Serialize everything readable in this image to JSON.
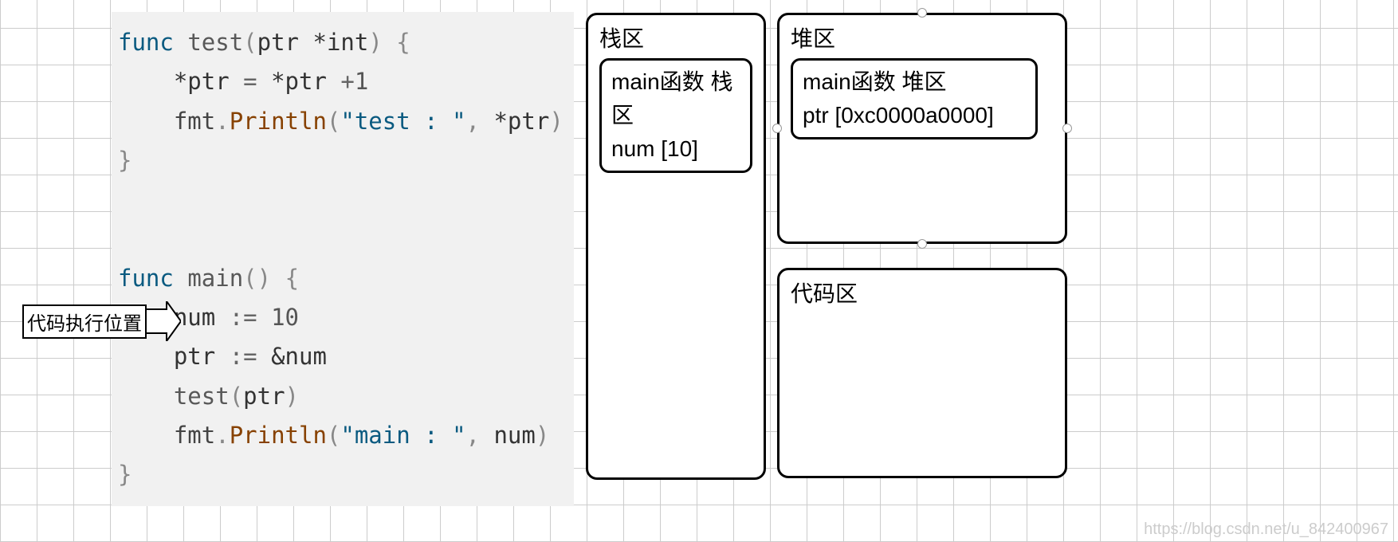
{
  "arrow": {
    "label": "代码执行位置"
  },
  "code": {
    "func_kw": "func",
    "test_name": "test",
    "test_params_open": "(",
    "ptr_param": "ptr",
    "ptr_type": "*int",
    "params_close": ")",
    "brace_open": "{",
    "brace_close": "}",
    "line2_a": "*ptr",
    "line2_eq": "=",
    "line2_b": "*ptr",
    "line2_plus": "+",
    "line2_one": "1",
    "fmt": "fmt",
    "dot": ".",
    "println": "Println",
    "paren_open": "(",
    "paren_close": ")",
    "str_test": "\"test : \"",
    "comma": ",",
    "deref_ptr": "*ptr",
    "main_name": "main",
    "num_ident": "num",
    "assign": ":=",
    "ten": "10",
    "ptr_ident": "ptr",
    "amp_num": "&num",
    "call_test": "test",
    "call_arg": "ptr",
    "str_main": "\"main : \"",
    "main_last_arg": "num"
  },
  "stack": {
    "title": "栈区",
    "box_line1": "main函数 栈区",
    "box_line2": "num [10]"
  },
  "heap": {
    "title": "堆区",
    "box_line1": "main函数 堆区",
    "box_line2": "ptr [0xc0000a0000]"
  },
  "codearea": {
    "title": "代码区"
  },
  "watermark": "https://blog.csdn.net/u_842400967"
}
